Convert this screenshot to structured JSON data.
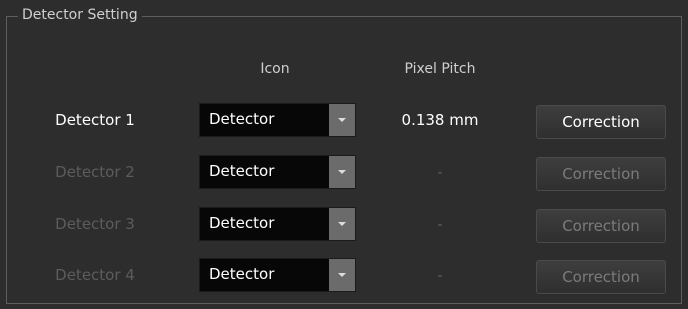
{
  "panel": {
    "title": "Detector Setting",
    "headers": {
      "icon": "Icon",
      "pixel_pitch": "Pixel Pitch"
    }
  },
  "detectors": [
    {
      "label": "Detector 1",
      "icon_value": "Detector",
      "pixel_pitch": "0.138 mm",
      "button": "Correction",
      "enabled": true
    },
    {
      "label": "Detector 2",
      "icon_value": "Detector",
      "pixel_pitch": "-",
      "button": "Correction",
      "enabled": false
    },
    {
      "label": "Detector 3",
      "icon_value": "Detector",
      "pixel_pitch": "-",
      "button": "Correction",
      "enabled": false
    },
    {
      "label": "Detector 4",
      "icon_value": "Detector",
      "pixel_pitch": "-",
      "button": "Correction",
      "enabled": false
    }
  ],
  "colors": {
    "background": "#2d2d2d",
    "enabled_text": "#ffffff",
    "disabled_text": "#5c5c5c",
    "dropdown_bg": "#070707",
    "dropdown_arrow": "#6b6b6b"
  },
  "icons": {
    "dropdown_arrow": "chevron-down-icon"
  }
}
